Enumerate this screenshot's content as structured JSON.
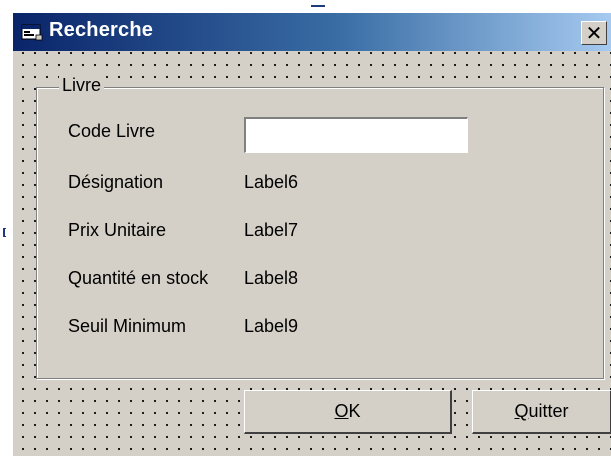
{
  "window": {
    "title": "Recherche",
    "close_label": "✕"
  },
  "frame": {
    "legend": "Livre"
  },
  "fields": {
    "code_livre_label": "Code Livre",
    "code_livre_value": "",
    "designation_label": "Désignation",
    "designation_value": "Label6",
    "prix_label": "Prix Unitaire",
    "prix_value": "Label7",
    "quantite_label": "Quantité en stock",
    "quantite_value": "Label8",
    "seuil_label": "Seuil Minimum",
    "seuil_value": "Label9"
  },
  "buttons": {
    "ok": {
      "mnemonic": "O",
      "rest": "K"
    },
    "quit": {
      "mnemonic": "Q",
      "rest": "uitter"
    }
  },
  "colors": {
    "titlebar_start": "#0a246a",
    "titlebar_end": "#a6caf0",
    "face": "#d4d0c8"
  },
  "icons": {
    "app": "form-window-icon",
    "close": "close-icon"
  }
}
